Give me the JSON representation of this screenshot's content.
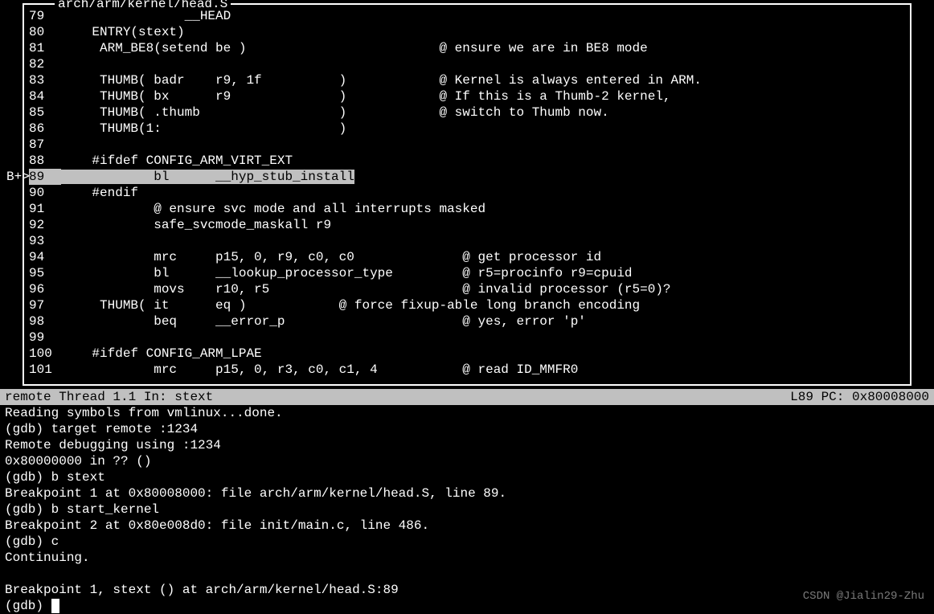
{
  "source": {
    "title": "arch/arm/kernel/head.S",
    "breakpointMarker": "B+>",
    "breakpointLine": 89,
    "lines": [
      {
        "n": 79,
        "text": "                __HEAD"
      },
      {
        "n": 80,
        "text": "    ENTRY(stext)"
      },
      {
        "n": 81,
        "text": "     ARM_BE8(setend be )                         @ ensure we are in BE8 mode"
      },
      {
        "n": 82,
        "text": ""
      },
      {
        "n": 83,
        "text": "     THUMB( badr    r9, 1f          )            @ Kernel is always entered in ARM."
      },
      {
        "n": 84,
        "text": "     THUMB( bx      r9              )            @ If this is a Thumb-2 kernel,"
      },
      {
        "n": 85,
        "text": "     THUMB( .thumb                  )            @ switch to Thumb now."
      },
      {
        "n": 86,
        "text": "     THUMB(1:                       )"
      },
      {
        "n": 87,
        "text": ""
      },
      {
        "n": 88,
        "text": "    #ifdef CONFIG_ARM_VIRT_EXT"
      },
      {
        "n": 89,
        "text": "            bl      __hyp_stub_install"
      },
      {
        "n": 90,
        "text": "    #endif"
      },
      {
        "n": 91,
        "text": "            @ ensure svc mode and all interrupts masked"
      },
      {
        "n": 92,
        "text": "            safe_svcmode_maskall r9"
      },
      {
        "n": 93,
        "text": ""
      },
      {
        "n": 94,
        "text": "            mrc     p15, 0, r9, c0, c0              @ get processor id"
      },
      {
        "n": 95,
        "text": "            bl      __lookup_processor_type         @ r5=procinfo r9=cpuid"
      },
      {
        "n": 96,
        "text": "            movs    r10, r5                         @ invalid processor (r5=0)?"
      },
      {
        "n": 97,
        "text": "     THUMB( it      eq )            @ force fixup-able long branch encoding"
      },
      {
        "n": 98,
        "text": "            beq     __error_p                       @ yes, error 'p'"
      },
      {
        "n": 99,
        "text": ""
      },
      {
        "n": 100,
        "text": "    #ifdef CONFIG_ARM_LPAE"
      },
      {
        "n": 101,
        "text": "            mrc     p15, 0, r3, c0, c1, 4           @ read ID_MMFR0"
      }
    ]
  },
  "status": {
    "left": "remote Thread 1.1 In: stext",
    "right": "L89   PC: 0x80008000"
  },
  "console": {
    "lines": [
      "Reading symbols from vmlinux...done.",
      "(gdb) target remote :1234",
      "Remote debugging using :1234",
      "0x80000000 in ?? ()",
      "(gdb) b stext",
      "Breakpoint 1 at 0x80008000: file arch/arm/kernel/head.S, line 89.",
      "(gdb) b start_kernel",
      "Breakpoint 2 at 0x80e008d0: file init/main.c, line 486.",
      "(gdb) c",
      "Continuing.",
      "",
      "Breakpoint 1, stext () at arch/arm/kernel/head.S:89"
    ],
    "prompt": "(gdb) "
  },
  "watermark": "CSDN @Jialin29-Zhu"
}
